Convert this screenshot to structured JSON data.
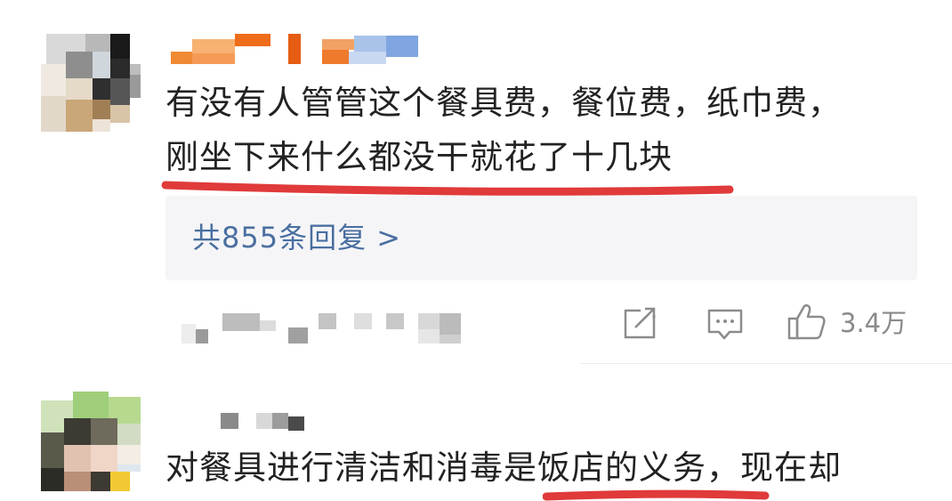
{
  "comments": [
    {
      "text_line1": "有没有人管管这个餐具费，餐位费，纸巾费，",
      "text_line2": "刚坐下来什么都没干就花了十几块",
      "replies_link": "共855条回复 >",
      "actions": {
        "share_icon": "share-icon",
        "comment_icon": "comment-icon",
        "like_icon": "thumbs-up-icon",
        "like_count": "3.4万"
      }
    },
    {
      "text_line1": "对餐具进行清洁和消毒是饭店的义务，现在却"
    }
  ],
  "colors": {
    "annotation_red": "#e03a3a",
    "reply_link": "#4a6fa0",
    "reply_bg": "#f5f5f7"
  }
}
